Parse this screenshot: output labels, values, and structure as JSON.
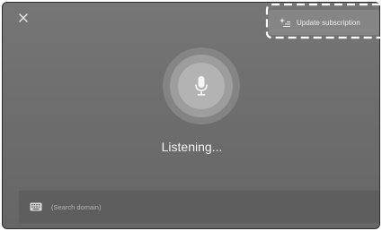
{
  "header": {
    "close_icon": "close-icon",
    "update_button": {
      "icon": "sparkle-icon",
      "label": "Update subscription"
    }
  },
  "main": {
    "mic_icon": "microphone-icon",
    "status": "Listening..."
  },
  "search": {
    "icon": "keyboard-icon",
    "placeholder": "(Search domain)"
  },
  "colors": {
    "background": "#6f6f6f",
    "panel": "#5e5e5e",
    "text": "#f2f2f2"
  }
}
